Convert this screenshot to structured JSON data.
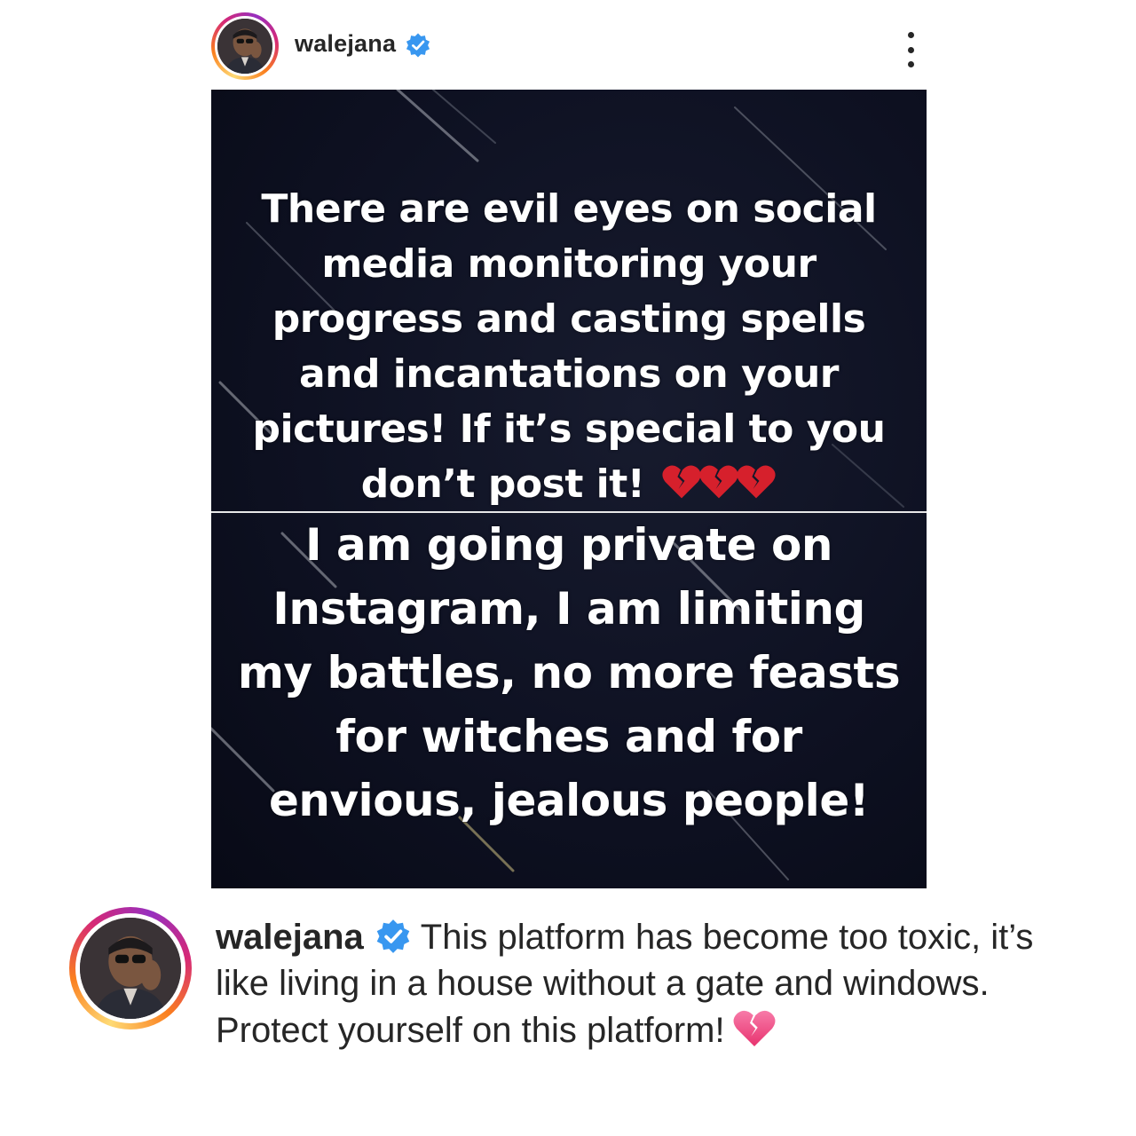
{
  "header": {
    "username": "walejana",
    "verified_icon": "verified-badge-icon",
    "more_icon": "more-options-icon"
  },
  "post_image": {
    "text_top": "There are evil eyes on social media monitoring your progress and casting spells and incantations on your pictures! If it’s special to you don’t post it!",
    "text_bottom": "I am going private on Instagram, I am limiting my battles, no more feasts for witches and for envious, jealous people!",
    "emoji": "broken-heart-icon",
    "emoji_count": 3
  },
  "caption": {
    "username": "walejana",
    "text": "This platform has become too toxic, it’s like living in a house without a gate and windows. Protect yourself on this platform!",
    "emoji": "pink-broken-heart-icon"
  },
  "colors": {
    "verified_blue": "#3897f0",
    "text_dark": "#262626",
    "image_bg": "#0d1020",
    "broken_heart_red": "#d6202c",
    "pink_heart": "#f0508c"
  }
}
